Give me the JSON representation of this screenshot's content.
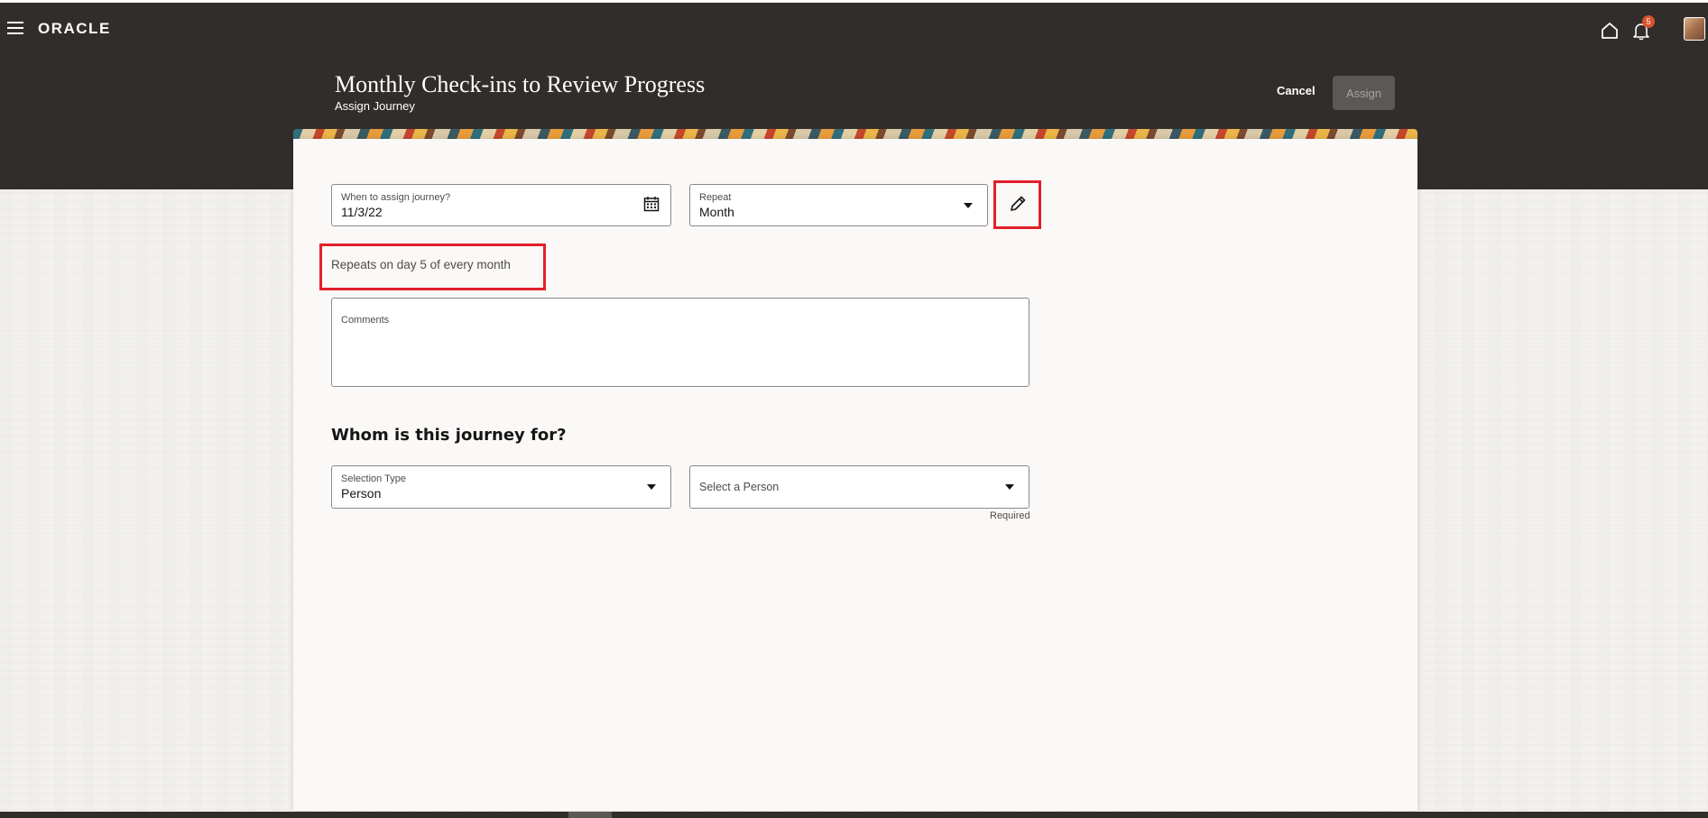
{
  "header": {
    "logo": "ORACLE",
    "notification_count": "5",
    "page_title": "Monthly Check-ins to Review Progress",
    "page_subtitle": "Assign Journey",
    "cancel_label": "Cancel",
    "assign_label": "Assign",
    "icons": {
      "menu": "hamburger-icon",
      "home": "home-icon",
      "notifications": "bell-icon",
      "profile": "avatar"
    }
  },
  "form": {
    "assign_date": {
      "label": "When to assign journey?",
      "value": "11/3/22",
      "icon": "calendar-icon"
    },
    "repeat": {
      "label": "Repeat",
      "value": "Month",
      "icon": "chevron-down-icon"
    },
    "edit_icon": "pencil-icon",
    "repeat_summary": "Repeats on day 5 of every month",
    "comments": {
      "label": "Comments",
      "value": ""
    }
  },
  "audience": {
    "heading": "Whom is this journey for?",
    "selection_type": {
      "label": "Selection Type",
      "value": "Person"
    },
    "person": {
      "placeholder": "Select a Person"
    },
    "required_note": "Required"
  },
  "colors": {
    "header_bg": "#312d2a",
    "highlight": "#e3202a",
    "badge": "#d9532b"
  }
}
